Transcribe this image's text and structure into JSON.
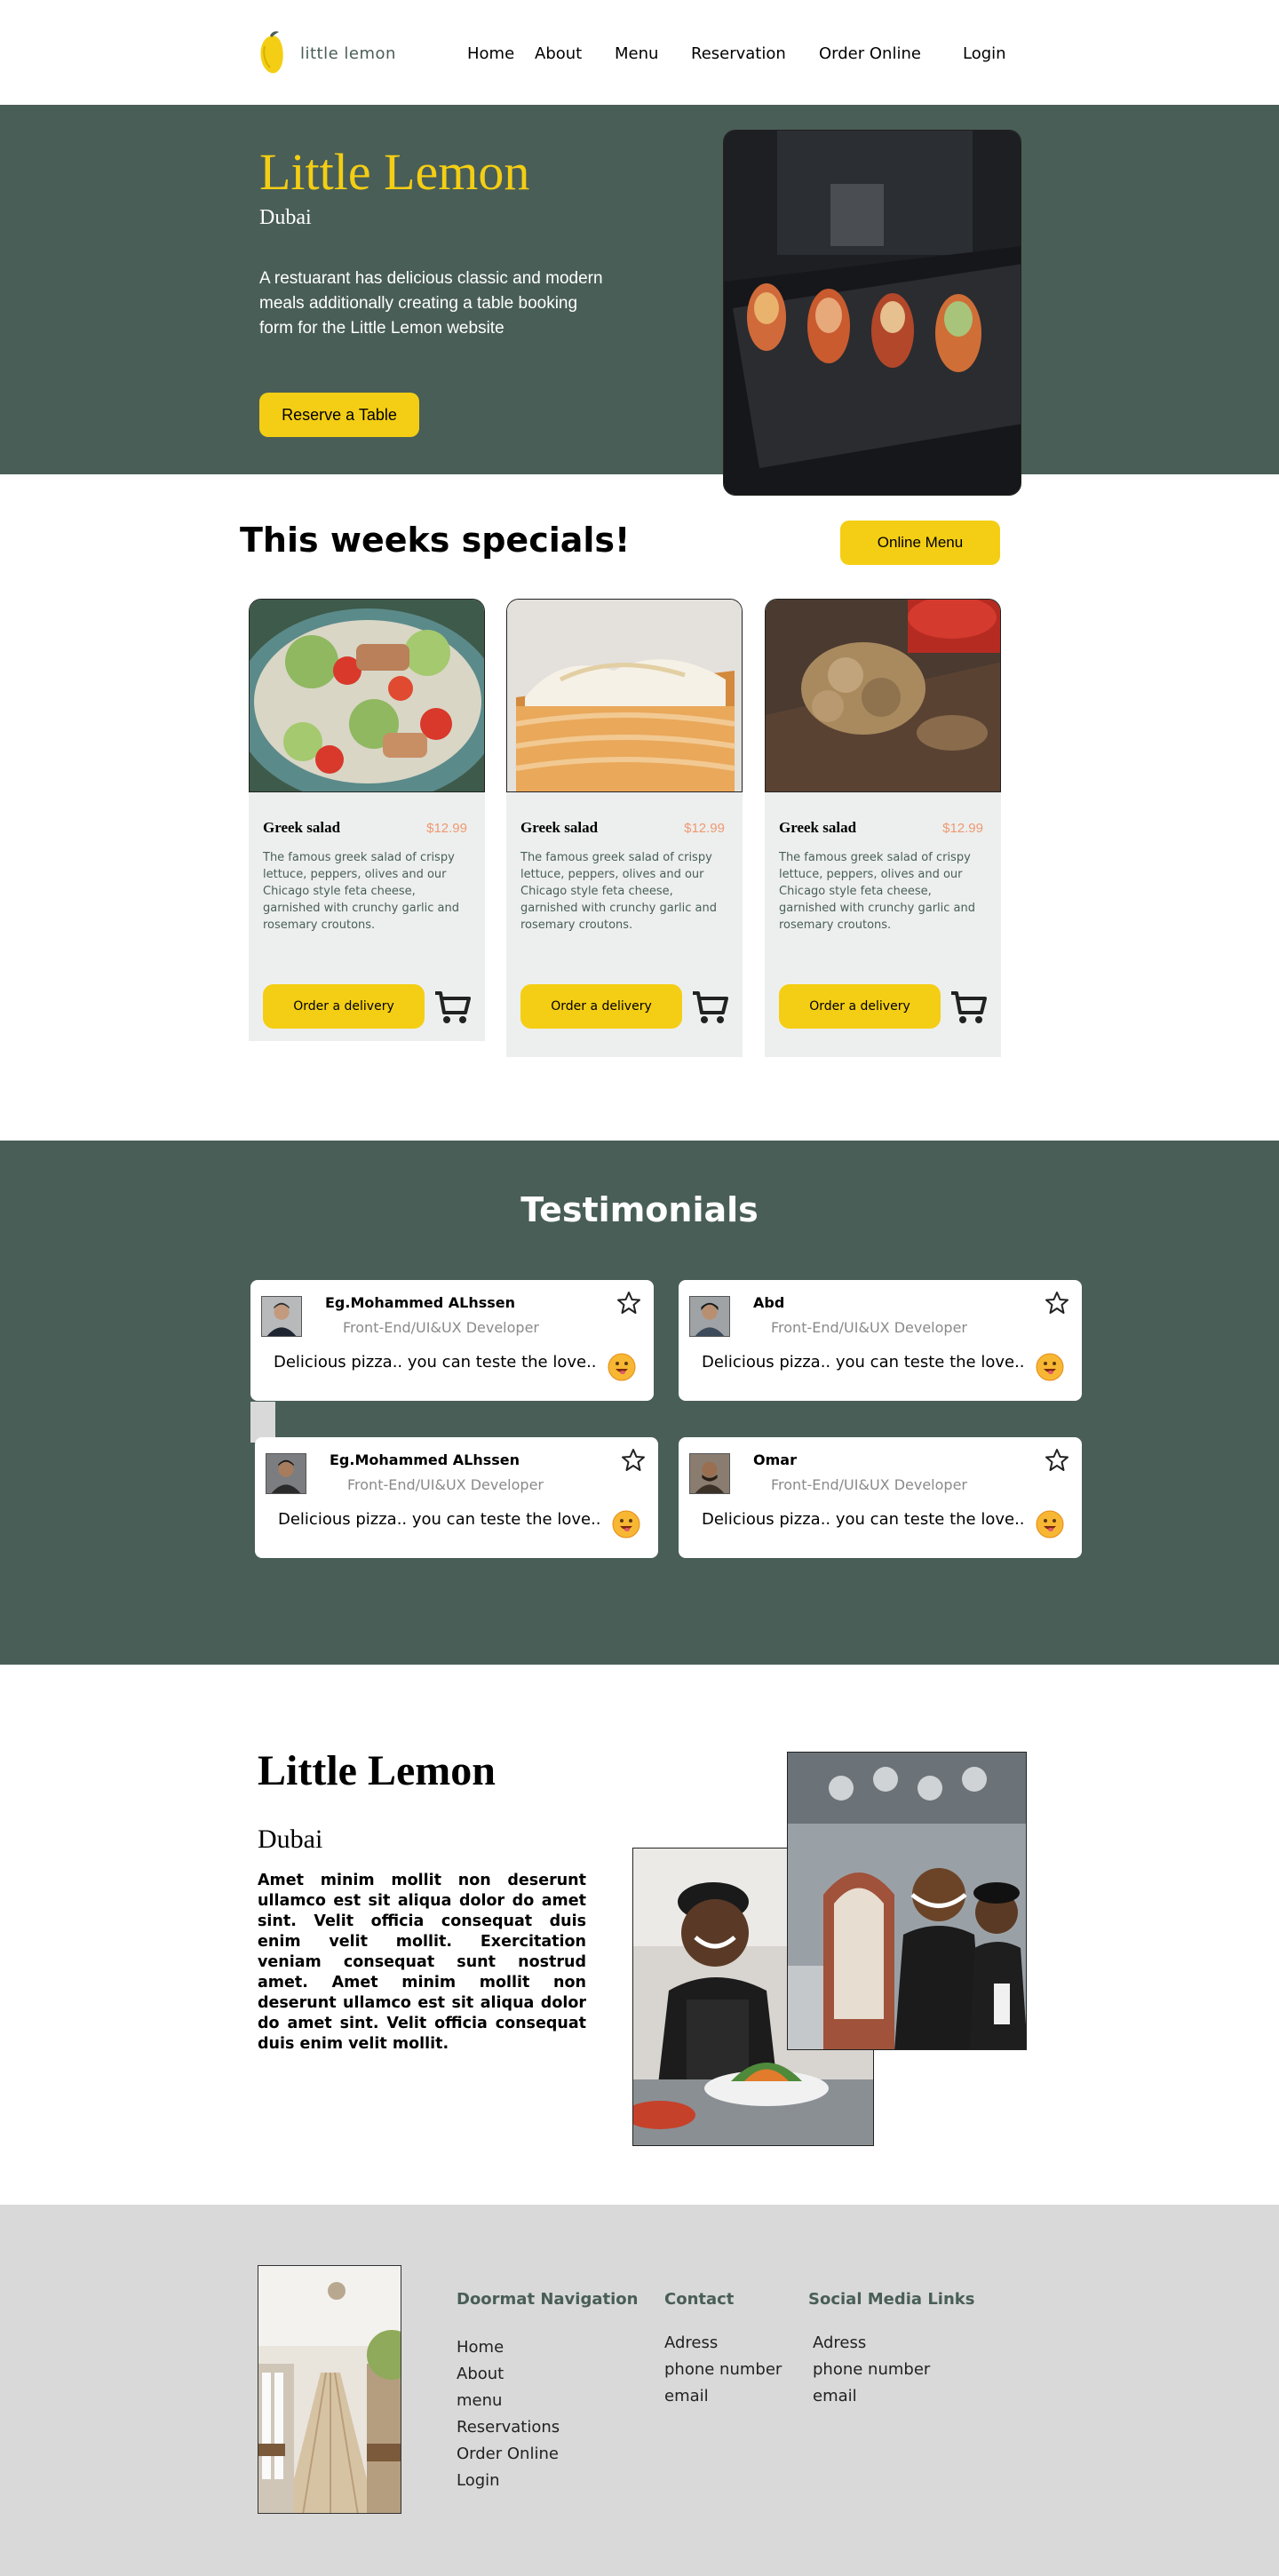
{
  "nav": {
    "logo_text": "little lemon",
    "links": [
      "Home",
      "About",
      "Menu",
      "Reservation",
      "Order Online",
      "Login"
    ]
  },
  "hero": {
    "title": "Little Lemon",
    "subtitle": "Dubai",
    "description": "A restuarant has delicious classic and modern meals additionally creating a table booking form for the Little Lemon website",
    "cta": "Reserve a Table"
  },
  "specials": {
    "title": "This weeks specials!",
    "menu_button": "Online Menu",
    "cards": [
      {
        "name": "Greek salad",
        "price": "$12.99",
        "description": "The famous greek salad of crispy lettuce, peppers, olives and our Chicago style feta cheese, garnished with crunchy garlic and rosemary croutons.",
        "button": "Order a delivery"
      },
      {
        "name": "Greek salad",
        "price": "$12.99",
        "description": "The famous greek salad of crispy lettuce, peppers, olives and our Chicago style feta cheese, garnished with crunchy garlic and rosemary croutons.",
        "button": "Order a delivery"
      },
      {
        "name": "Greek salad",
        "price": "$12.99",
        "description": "The famous greek salad of crispy lettuce, peppers, olives and our Chicago style feta cheese, garnished with crunchy garlic and rosemary croutons.",
        "button": "Order a delivery"
      }
    ]
  },
  "testimonials": {
    "title": "Testimonials",
    "items": [
      {
        "name": "Eg.Mohammed ALhssen",
        "role": "Front-End/UI&UX Developer",
        "text": "Delicious pizza.. you can teste the love.."
      },
      {
        "name": "Abd",
        "role": "Front-End/UI&UX Developer",
        "text": "Delicious pizza.. you can teste the love.."
      },
      {
        "name": "Eg.Mohammed ALhssen",
        "role": "Front-End/UI&UX Developer",
        "text": "Delicious pizza.. you can teste the love.."
      },
      {
        "name": "Omar",
        "role": "Front-End/UI&UX Developer",
        "text": "Delicious pizza.. you can teste the love.."
      }
    ]
  },
  "about": {
    "title": "Little Lemon",
    "subtitle": "Dubai",
    "text": "Amet minim mollit non deserunt ullamco est sit aliqua dolor do amet sint. Velit officia consequat duis enim velit mollit. Exercitation veniam consequat sunt nostrud amet. Amet minim mollit non deserunt ullamco est sit aliqua dolor do amet sint. Velit officia consequat duis enim velit mollit."
  },
  "footer": {
    "doormat": {
      "title": "Doormat Navigation",
      "links": [
        "Home",
        "About",
        "menu",
        "Reservations",
        "Order Online",
        "Login"
      ]
    },
    "contact": {
      "title": "Contact",
      "items": [
        "Adress",
        "phone number",
        "email"
      ]
    },
    "social": {
      "title": "Social Media Links",
      "items": [
        "Adress",
        "phone number",
        "email"
      ]
    }
  },
  "colors": {
    "primary_green": "#495e57",
    "primary_yellow": "#f4ce14",
    "price_salmon": "#ee9972",
    "card_bg": "#edefee",
    "footer_bg": "#d9d9d9"
  }
}
